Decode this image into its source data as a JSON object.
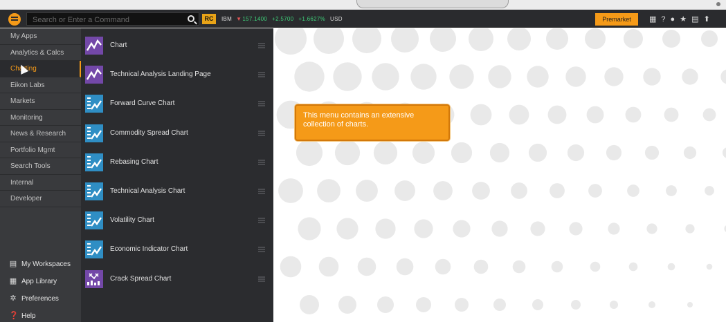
{
  "toolbar": {
    "search_placeholder": "Search or Enter a Command",
    "rc_badge": "RC",
    "quote": {
      "ric": "IBM",
      "direction": "▼",
      "last": "157.1400",
      "change": "+2.5700",
      "change_pct": "+1.6627%",
      "currency": "USD"
    },
    "premarket_label": "Premarket",
    "icons": [
      "grid-icon",
      "help-icon",
      "chat-icon",
      "star-icon",
      "print-icon",
      "pin-icon"
    ]
  },
  "categories": [
    {
      "label": "My Apps"
    },
    {
      "label": "Analytics & Calcs"
    },
    {
      "label": "Charting",
      "active": true
    },
    {
      "label": "Eikon Labs"
    },
    {
      "label": "Markets"
    },
    {
      "label": "Monitoring"
    },
    {
      "label": "News & Research"
    },
    {
      "label": "Portfolio Mgmt"
    },
    {
      "label": "Search Tools"
    },
    {
      "label": "Internal"
    },
    {
      "label": "Developer"
    }
  ],
  "utilities": [
    {
      "label": "My Workspaces",
      "icon": "workspaces-icon"
    },
    {
      "label": "App Library",
      "icon": "app-library-icon"
    },
    {
      "label": "Preferences",
      "icon": "gear-icon"
    },
    {
      "label": "Help",
      "icon": "help-circle-icon"
    }
  ],
  "apps": [
    {
      "label": "Chart",
      "icon": "line-chart-icon",
      "color": "#7348a8"
    },
    {
      "label": "Technical Analysis Landing Page",
      "icon": "line-chart-icon",
      "color": "#7348a8"
    },
    {
      "label": "Forward Curve Chart",
      "icon": "doc-chart-icon",
      "color": "#2f8ec4"
    },
    {
      "label": "Commodity Spread Chart",
      "icon": "doc-chart-icon",
      "color": "#2f8ec4"
    },
    {
      "label": "Rebasing Chart",
      "icon": "doc-chart-icon",
      "color": "#2f8ec4"
    },
    {
      "label": "Technical Analysis Chart",
      "icon": "doc-chart-icon",
      "color": "#2f8ec4"
    },
    {
      "label": "Volatility Chart",
      "icon": "doc-chart-icon",
      "color": "#2f8ec4"
    },
    {
      "label": "Economic Indicator Chart",
      "icon": "doc-chart-icon",
      "color": "#2f8ec4"
    },
    {
      "label": "Crack Spread Chart",
      "icon": "crack-spread-icon",
      "color": "#7348a8"
    }
  ],
  "tooltip": {
    "line1": "This menu contains an extensive",
    "line2": "collection of charts."
  },
  "colors": {
    "accent": "#f59a18",
    "toolbar_bg": "#2a2b2e",
    "nav_bg": "#393a3d",
    "panel_bg": "#2b2c2f",
    "up": "#3fd07a",
    "down": "#e05555"
  }
}
